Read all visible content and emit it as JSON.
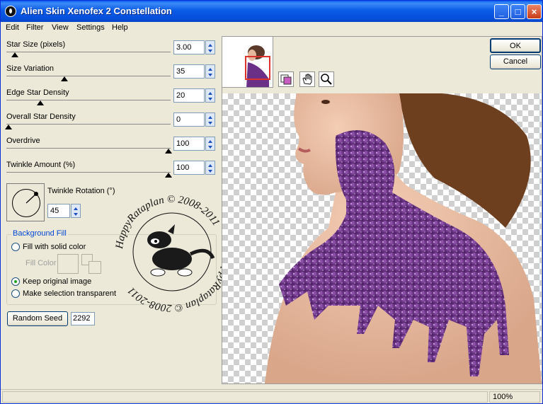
{
  "window": {
    "title": "Alien Skin Xenofex 2 Constellation"
  },
  "menu": [
    "Edit",
    "Filter",
    "View",
    "Settings",
    "Help"
  ],
  "params": [
    {
      "label": "Star Size (pixels)",
      "value": "3.00",
      "level": 0.04
    },
    {
      "label": "Size Variation",
      "value": "35",
      "level": 0.35
    },
    {
      "label": "Edge Star Density",
      "value": "20",
      "level": 0.2
    },
    {
      "label": "Overall Star Density",
      "value": "0",
      "level": 0
    },
    {
      "label": "Overdrive",
      "value": "100",
      "level": 1
    },
    {
      "label": "Twinkle Amount (%)",
      "value": "100",
      "level": 1
    }
  ],
  "rotation": {
    "label": "Twinkle Rotation (°)",
    "value": "45"
  },
  "background_fill": {
    "title": "Background Fill",
    "options": [
      "Fill with solid color",
      "Keep original image",
      "Make selection transparent"
    ],
    "selected": "Keep original image",
    "fill_color_label": "Fill Color"
  },
  "seed": {
    "button": "Random Seed",
    "value": "2292"
  },
  "buttons": {
    "ok": "OK",
    "cancel": "Cancel"
  },
  "watermark": {
    "top": "HappyRataplan © 2008-2011",
    "bottom": "HappyRataplan © 2008-2011"
  },
  "status": {
    "zoom": "100%"
  },
  "colors": {
    "title_blue": "#0553dc",
    "accent_purple": "#6a2f86",
    "link_blue": "#0046d5"
  }
}
